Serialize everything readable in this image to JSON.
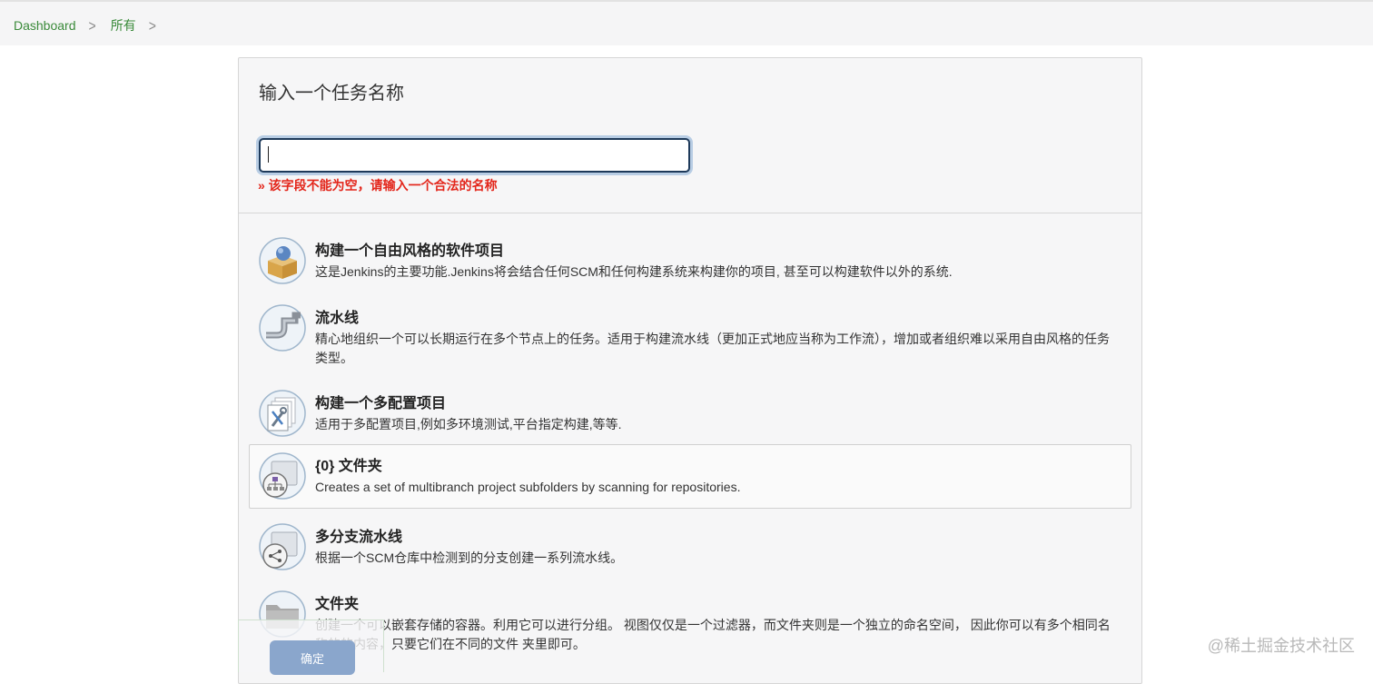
{
  "breadcrumb": {
    "dashboard": "Dashboard",
    "all": "所有"
  },
  "form": {
    "heading": "输入一个任务名称",
    "name_value": "",
    "error": "» 该字段不能为空，请输入一个合法的名称"
  },
  "items": [
    {
      "title": "构建一个自由风格的软件项目",
      "desc": "这是Jenkins的主要功能.Jenkins将会结合任何SCM和任何构建系统来构建你的项目, 甚至可以构建软件以外的系统.",
      "icon": "freestyle-box-icon"
    },
    {
      "title": "流水线",
      "desc": "精心地组织一个可以长期运行在多个节点上的任务。适用于构建流水线（更加正式地应当称为工作流），增加或者组织难以采用自由风格的任务类型。",
      "icon": "pipeline-icon"
    },
    {
      "title": "构建一个多配置项目",
      "desc": "适用于多配置项目,例如多环境测试,平台指定构建,等等.",
      "icon": "multi-config-icon"
    },
    {
      "title": "{0} 文件夹",
      "desc": "Creates a set of multibranch project subfolders by scanning for repositories.",
      "icon": "org-folder-icon"
    },
    {
      "title": "多分支流水线",
      "desc": "根据一个SCM仓库中检测到的分支创建一系列流水线。",
      "icon": "multibranch-icon"
    },
    {
      "title": "文件夹",
      "desc": "创建一个可以嵌套存储的容器。利用它可以进行分组。 视图仅仅是一个过滤器，而文件夹则是一个独立的命名空间， 因此你可以有多个相同名称的的内容，只要它们在不同的文件 夹里即可。",
      "icon": "folder-icon"
    }
  ],
  "ok_button": "确定",
  "watermark": "@稀土掘金技术社区"
}
